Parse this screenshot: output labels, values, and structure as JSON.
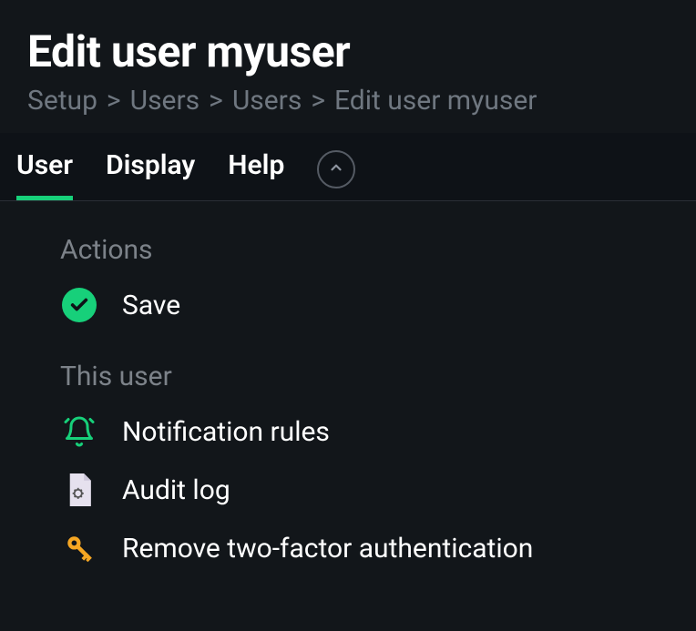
{
  "header": {
    "title": "Edit user myuser"
  },
  "breadcrumb": {
    "items": [
      "Setup",
      "Users",
      "Users",
      "Edit user myuser"
    ]
  },
  "tabs": {
    "items": [
      "User",
      "Display",
      "Help"
    ],
    "active": 0
  },
  "sections": {
    "actions": {
      "title": "Actions",
      "items": [
        {
          "label": "Save"
        }
      ]
    },
    "this_user": {
      "title": "This user",
      "items": [
        {
          "label": "Notification rules"
        },
        {
          "label": "Audit log"
        },
        {
          "label": "Remove two-factor authentication"
        }
      ]
    }
  }
}
